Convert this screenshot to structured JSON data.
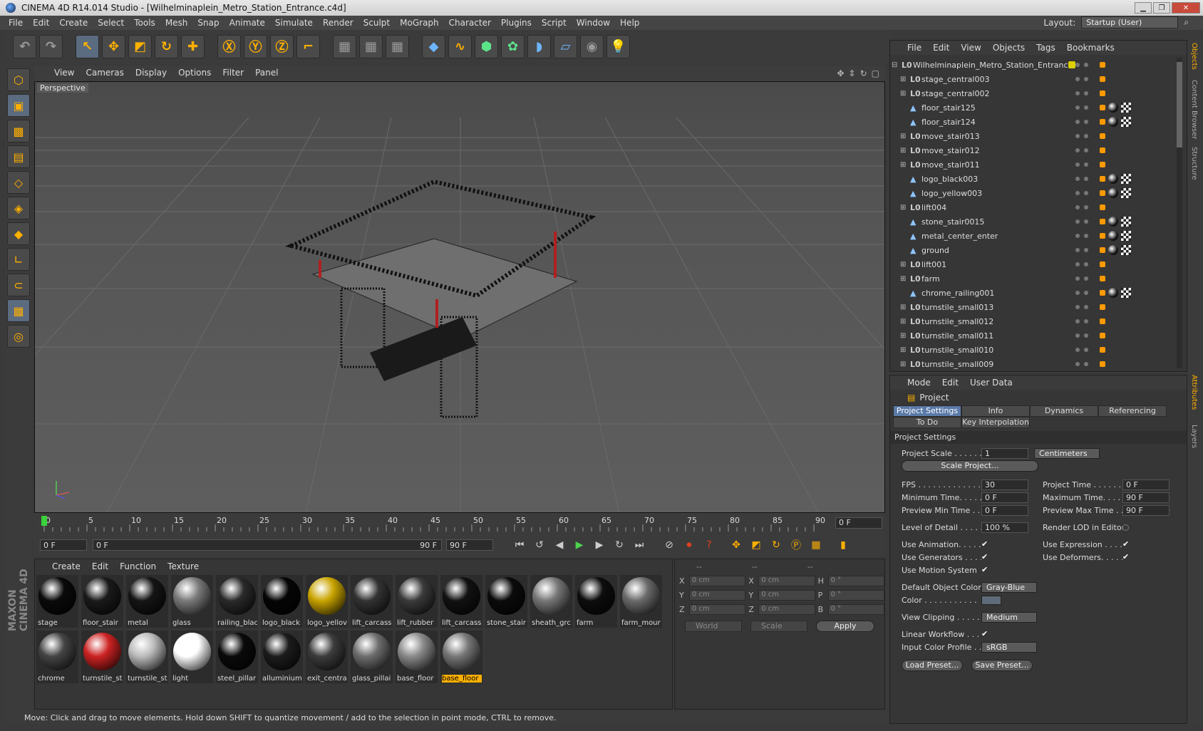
{
  "window": {
    "title": "CINEMA 4D R14.014 Studio - [Wilhelminaplein_Metro_Station_Entrance.c4d]"
  },
  "menu": [
    "File",
    "Edit",
    "Create",
    "Select",
    "Tools",
    "Mesh",
    "Snap",
    "Animate",
    "Simulate",
    "Render",
    "Sculpt",
    "MoGraph",
    "Character",
    "Plugins",
    "Script",
    "Window",
    "Help"
  ],
  "layout": {
    "label": "Layout:",
    "value": "Startup (User)"
  },
  "viewport": {
    "menu": [
      "View",
      "Cameras",
      "Display",
      "Options",
      "Filter",
      "Panel"
    ],
    "label": "Perspective"
  },
  "timeline": {
    "ticks": [
      "0",
      "5",
      "10",
      "15",
      "20",
      "25",
      "30",
      "35",
      "40",
      "45",
      "50",
      "55",
      "60",
      "65",
      "70",
      "75",
      "80",
      "85",
      "90"
    ],
    "current_frame": "0 F",
    "start": "0 F",
    "range_start": "0 F",
    "range_end": "90 F",
    "end": "90 F"
  },
  "materials": {
    "menu": [
      "Create",
      "Edit",
      "Function",
      "Texture"
    ],
    "items": [
      {
        "name": "stage",
        "color": "#0a0a0a"
      },
      {
        "name": "floor_stair",
        "color": "#1a1a1a"
      },
      {
        "name": "metal",
        "color": "#151515"
      },
      {
        "name": "glass",
        "color": "#7a7a7a"
      },
      {
        "name": "railing_blac",
        "color": "#2a2a2a"
      },
      {
        "name": "logo_black",
        "color": "#050505"
      },
      {
        "name": "logo_yellov",
        "color": "#c9a400"
      },
      {
        "name": "lift_carcass",
        "color": "#333333"
      },
      {
        "name": "lift_rubber",
        "color": "#3a3a3a"
      },
      {
        "name": "lift_carcass",
        "color": "#111111"
      },
      {
        "name": "stone_stair",
        "color": "#0b0b0b"
      },
      {
        "name": "sheath_grc",
        "color": "#777777"
      },
      {
        "name": "farm",
        "color": "#0d0d0d"
      },
      {
        "name": "farm_mour",
        "color": "#6a6a6a"
      },
      {
        "name": "chrome",
        "color": "#444444"
      },
      {
        "name": "turnstile_st",
        "color": "#cc2222"
      },
      {
        "name": "turnstile_st",
        "color": "#bbbbbb"
      },
      {
        "name": "light",
        "color": "#ffffff"
      },
      {
        "name": "steel_pillar",
        "color": "#0a0a0a"
      },
      {
        "name": "alluminium",
        "color": "#1c1c1c"
      },
      {
        "name": "exit_centra",
        "color": "#3c3c3c"
      },
      {
        "name": "glass_pillai",
        "color": "#6e6e6e"
      },
      {
        "name": "base_floor",
        "color": "#8a8a8a"
      },
      {
        "name": "base_floor",
        "color": "#777777",
        "selected": true
      }
    ]
  },
  "coords": {
    "rows": [
      {
        "a": "X",
        "v1": "0 cm",
        "b": "X",
        "v2": "0 cm",
        "c": "H",
        "v3": "0 °"
      },
      {
        "a": "Y",
        "v1": "0 cm",
        "b": "Y",
        "v2": "0 cm",
        "c": "P",
        "v3": "0 °"
      },
      {
        "a": "Z",
        "v1": "0 cm",
        "b": "Z",
        "v2": "0 cm",
        "c": "B",
        "v3": "0 °"
      }
    ],
    "world": "World",
    "scale": "Scale",
    "apply": "Apply"
  },
  "status": "Move: Click and drag to move elements. Hold down SHIFT to quantize movement / add to the selection in point mode, CTRL to remove.",
  "objects": {
    "menu": [
      "File",
      "Edit",
      "View",
      "Objects",
      "Tags",
      "Bookmarks"
    ],
    "root": "Wilhelminaplein_Metro_Station_Entrance",
    "items": [
      {
        "name": "stage_central003",
        "type": "null",
        "tags": "none"
      },
      {
        "name": "stage_central002",
        "type": "null",
        "tags": "none"
      },
      {
        "name": "floor_stair125",
        "type": "poly",
        "tags": "mat"
      },
      {
        "name": "floor_stair124",
        "type": "poly",
        "tags": "mat"
      },
      {
        "name": "move_stair013",
        "type": "null",
        "tags": "none"
      },
      {
        "name": "move_stair012",
        "type": "null",
        "tags": "none"
      },
      {
        "name": "move_stair011",
        "type": "null",
        "tags": "none"
      },
      {
        "name": "logo_black003",
        "type": "poly",
        "tags": "mat"
      },
      {
        "name": "logo_yellow003",
        "type": "poly",
        "tags": "mat"
      },
      {
        "name": "lift004",
        "type": "null",
        "tags": "none"
      },
      {
        "name": "stone_stair0015",
        "type": "poly",
        "tags": "mat"
      },
      {
        "name": "metal_center_enter",
        "type": "poly",
        "tags": "mat"
      },
      {
        "name": "ground",
        "type": "poly",
        "tags": "mat"
      },
      {
        "name": "lift001",
        "type": "null",
        "tags": "none"
      },
      {
        "name": "farm",
        "type": "null",
        "tags": "none"
      },
      {
        "name": "chrome_railing001",
        "type": "poly",
        "tags": "mat"
      },
      {
        "name": "turnstile_small013",
        "type": "null",
        "tags": "none"
      },
      {
        "name": "turnstile_small012",
        "type": "null",
        "tags": "none"
      },
      {
        "name": "turnstile_small011",
        "type": "null",
        "tags": "none"
      },
      {
        "name": "turnstile_small010",
        "type": "null",
        "tags": "none"
      },
      {
        "name": "turnstile_small009",
        "type": "null",
        "tags": "none"
      }
    ]
  },
  "attributes": {
    "menu": [
      "Mode",
      "Edit",
      "User Data"
    ],
    "title": "Project",
    "tabs": [
      "Project Settings",
      "Info",
      "Dynamics",
      "Referencing",
      "To Do",
      "Key Interpolation"
    ],
    "section": "Project Settings",
    "project_scale_label": "Project Scale . . . . . .",
    "project_scale": "1",
    "units": "Centimeters",
    "scale_project": "Scale Project...",
    "fps_label": "FPS . . . . . . . . . . . . . .",
    "fps": "30",
    "project_time_label": "Project Time . . . . . . .",
    "project_time": "0 F",
    "min_time_label": "Minimum Time. . . . . .",
    "min_time": "0 F",
    "max_time_label": "Maximum Time. . . . . .",
    "max_time": "90 F",
    "prev_min_label": "Preview Min Time . . .",
    "prev_min": "0 F",
    "prev_max_label": "Preview Max Time . . .",
    "prev_max": "90 F",
    "lod_label": "Level of Detail . . . . .",
    "lod": "100 %",
    "render_lod_label": "Render LOD in Editor",
    "use_anim": "Use Animation. . . . .",
    "use_expr": "Use Expression . . . . .",
    "use_gen": "Use Generators . . . .",
    "use_deform": "Use Deformers. . . . . .",
    "use_motion": "Use Motion System",
    "def_color_label": "Default Object Color",
    "def_color": "Gray-Blue",
    "color_label": "Color . . . . . . . . . . .",
    "view_clip_label": "View Clipping . . . . . .",
    "view_clip": "Medium",
    "linear_label": "Linear Workflow . . . .",
    "input_profile_label": "Input Color Profile . .",
    "input_profile": "sRGB",
    "load_preset": "Load Preset...",
    "save_preset": "Save Preset..."
  },
  "right_tabs": [
    "Objects",
    "Content Browser",
    "Structure",
    "Attributes",
    "Layers"
  ]
}
